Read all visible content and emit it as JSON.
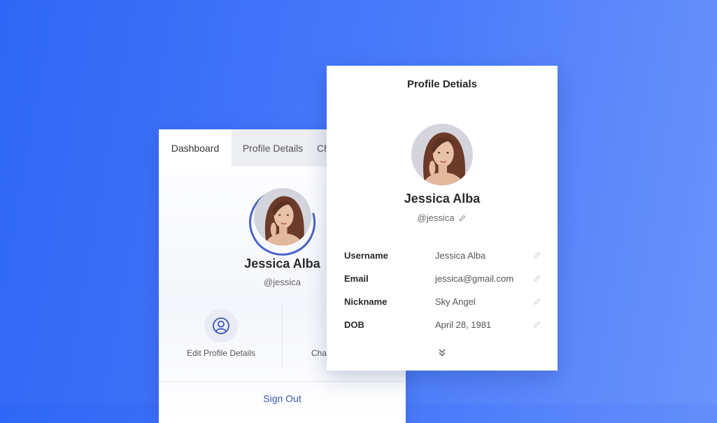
{
  "back_card": {
    "tabs": [
      {
        "label": "Dashboard"
      },
      {
        "label": "Profile Details"
      },
      {
        "label": "Ch"
      }
    ],
    "name": "Jessica Alba",
    "handle": "@jessica",
    "actions": [
      {
        "label": "Edit Profile Details",
        "icon": "user-circle-icon"
      },
      {
        "label": "Cha"
      }
    ],
    "sign_out": "Sign Out"
  },
  "front_card": {
    "title": "Profile Detials",
    "name": "Jessica Alba",
    "handle": "@jessica",
    "fields": [
      {
        "key": "Username",
        "value": "Jessica Alba"
      },
      {
        "key": "Email",
        "value": "jessica@gmail.com"
      },
      {
        "key": "Nickname",
        "value": "Sky Angel"
      },
      {
        "key": "DOB",
        "value": "April 28, 1981"
      }
    ]
  },
  "colors": {
    "accent": "#3a55b8",
    "background_start": "#2f66f5",
    "background_end": "#6a93fb"
  }
}
